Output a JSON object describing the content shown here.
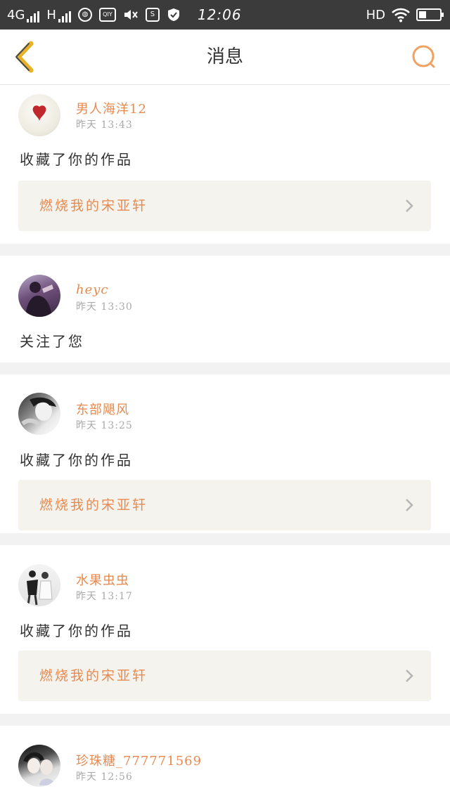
{
  "status_bar": {
    "network_4g": "4G",
    "network_h": "H",
    "icon_qiy": "QIY",
    "icon_s": "S",
    "time": "12:06",
    "hd": "HD",
    "battery_level": 0.35
  },
  "header": {
    "title": "消息"
  },
  "colors": {
    "accent": "#e88a4f",
    "back_arrow": "#e8b12a",
    "search_icon": "#f0a262"
  },
  "messages": [
    {
      "username": "男人海洋12",
      "time": "昨天  13:43",
      "action": "收藏了你的作品",
      "work": "燃烧我的宋亚轩"
    },
    {
      "username": "heyc",
      "time": "昨天  13:30",
      "action": "关注了您"
    },
    {
      "username": "东部飓风",
      "time": "昨天  13:25",
      "action": "收藏了你的作品",
      "work": "燃烧我的宋亚轩"
    },
    {
      "username": "水果虫虫",
      "time": "昨天  13:17",
      "action": "收藏了你的作品",
      "work": "燃烧我的宋亚轩"
    },
    {
      "username": "珍珠糖_777771569",
      "time": "昨天  12:56"
    }
  ]
}
